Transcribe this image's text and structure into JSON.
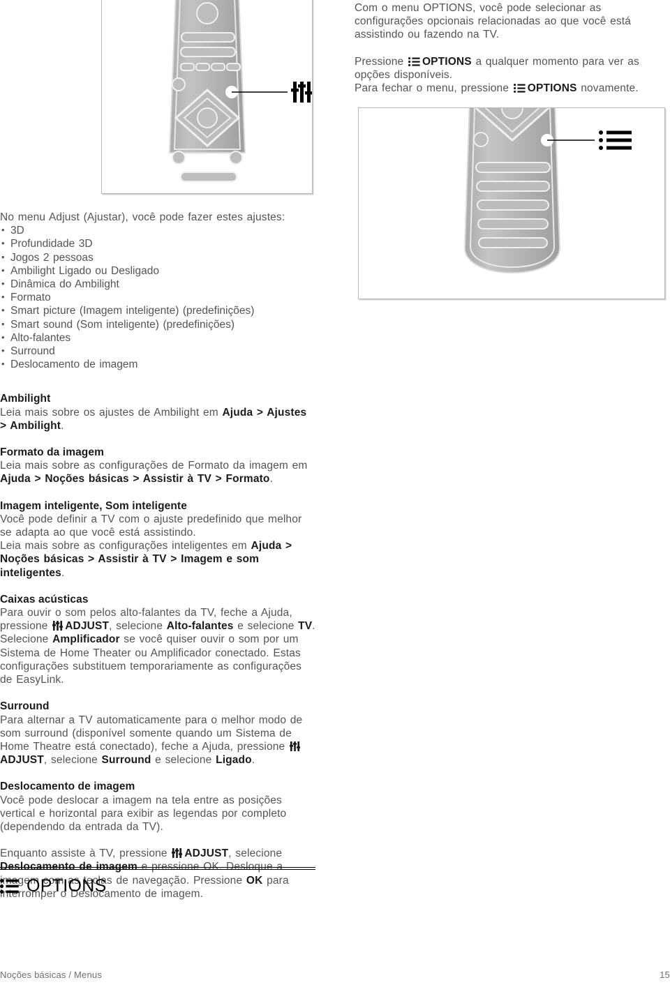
{
  "document": {
    "footer_left": "Noções básicas / Menus",
    "footer_page": "15"
  },
  "colors": {
    "body_text": "#545454",
    "heading_text": "#1a1a1a",
    "rule": "#000000",
    "figure_border": "#b9b9b9",
    "remote_body": "#b5b5b5"
  },
  "intro": {
    "para1": "Com o menu OPTIONS, você pode selecionar as configurações opcionais relacionadas ao que você está assistindo ou fazendo na TV.",
    "para2_before": "Pressione",
    "para2_icon": "options-list-icon",
    "para2_label": "OPTIONS",
    "para2_after": "a qualquer momento para ver as opções disponíveis.",
    "para3_before": "Para fechar o menu, pressione",
    "para3_icon": "options-list-icon",
    "para3_label": "OPTIONS",
    "para3_after": "novamente."
  },
  "adjust_list": {
    "intro": "No menu Adjust (Ajustar), você pode fazer estes ajustes:",
    "items": [
      "3D",
      "Profundidade 3D",
      "Jogos 2 pessoas",
      "Ambilight Ligado ou Desligado",
      "Dinâmica do Ambilight",
      "Formato",
      "Smart picture (Imagem inteligente) (predefinições)",
      "Smart sound (Som inteligente) (predefinições)",
      "Alto-falantes",
      "Surround",
      "Deslocamento de imagem"
    ]
  },
  "sections": {
    "ambilight": {
      "heading": "Ambilight",
      "body_1": "Leia mais sobre os ajustes de Ambilight em ",
      "bold_1": "Ajuda > Ajustes > Ambilight",
      "body_2": "."
    },
    "formato": {
      "heading": "Formato da imagem",
      "body_1": "Leia mais sobre as configurações de Formato da imagem em ",
      "bold_1": "Ajuda > Noções básicas > Assistir à TV > Formato",
      "body_2": "."
    },
    "smart": {
      "heading": "Imagem inteligente, Som inteligente",
      "body_1": "Você pode definir a TV com o ajuste predefinido que melhor se adapta ao que você está assistindo.",
      "body_2": "Leia mais sobre as configurações inteligentes em ",
      "bold_1": "Ajuda > Noções básicas > Assistir à TV > Imagem e som inteligentes",
      "body_3": "."
    },
    "caixas": {
      "heading": "Caixas acústicas",
      "body_1": "Para ouvir o som pelos alto-falantes da TV, feche a Ajuda, pressione ",
      "icon": "adjust-sliders-icon",
      "bold_adjust": "ADJUST",
      "body_2": ", selecione ",
      "bold_1": "Alto-falantes",
      "body_3": " e selecione ",
      "bold_2": "TV",
      "body_4": ". Selecione ",
      "bold_3": "Amplificador",
      "body_5": " se você quiser ouvir o som por um Sistema de Home Theater ou Amplificador conectado. Estas configurações substituem temporariamente as configurações de EasyLink."
    },
    "surround": {
      "heading": "Surround",
      "body_1": "Para alternar a TV automaticamente para o melhor modo de som surround (disponível somente quando um Sistema de Home Theatre está conectado), feche a Ajuda, pressione ",
      "icon": "adjust-sliders-icon",
      "bold_adjust": "ADJUST",
      "body_2": ", selecione ",
      "bold_1": "Surround",
      "body_3": " e selecione ",
      "bold_2": "Ligado",
      "body_4": "."
    },
    "deslocamento": {
      "heading": "Deslocamento de imagem",
      "body_1": "Você pode deslocar a imagem na tela entre as posições vertical e horizontal para exibir as legendas por completo (dependendo da entrada da TV).",
      "body_2": "Enquanto assiste à TV, pressione ",
      "icon": "adjust-sliders-icon",
      "bold_adjust": "ADJUST",
      "body_3": ", selecione ",
      "bold_1": "Deslocamento de imagem",
      "body_4": " e pressione OK. Desloque a imagem com as teclas de navegação. Pressione ",
      "bold_2": "OK",
      "body_5": " para interromper o Deslocamento de imagem."
    }
  },
  "options_section": {
    "icon": "options-list-icon",
    "title": "OPTIONS"
  },
  "figures": {
    "remote_adjust": {
      "caption_icon": "adjust-sliders-icon",
      "alt": "Controle remoto com o botão ADJUST destacado"
    },
    "remote_options": {
      "caption_icon": "options-list-icon",
      "alt": "Controle remoto com o botão OPTIONS destacado"
    }
  }
}
